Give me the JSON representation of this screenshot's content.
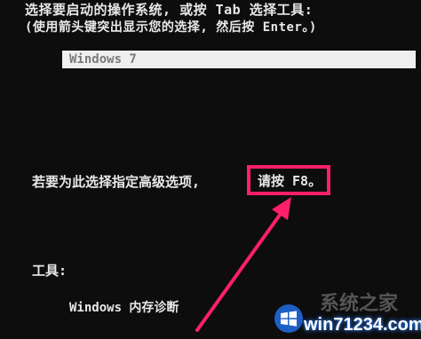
{
  "header": {
    "line1": "选择要启动的操作系统, 或按 Tab 选择工具:",
    "line2": "(使用箭头键突出显示您的选择, 然后按 Enter。)"
  },
  "os_list": {
    "items": [
      {
        "label": "Windows 7",
        "selected": true
      }
    ]
  },
  "advanced": {
    "prompt": "若要为此选择指定高级选项,",
    "key_hint": "请按 F8。"
  },
  "tools": {
    "label": "工具:",
    "items": [
      {
        "label": "Windows 内存诊断"
      }
    ]
  },
  "annotation": {
    "highlight_color": "#ff1f6a",
    "arrow_color": "#ff1f6a"
  },
  "watermark": {
    "text": "win71234.com",
    "faint_text": "系统之家"
  },
  "colors": {
    "background": "#0d0d0d",
    "text": "#e8e8e8",
    "selection_bg": "#efefef",
    "selection_text": "#7a7a7a"
  }
}
